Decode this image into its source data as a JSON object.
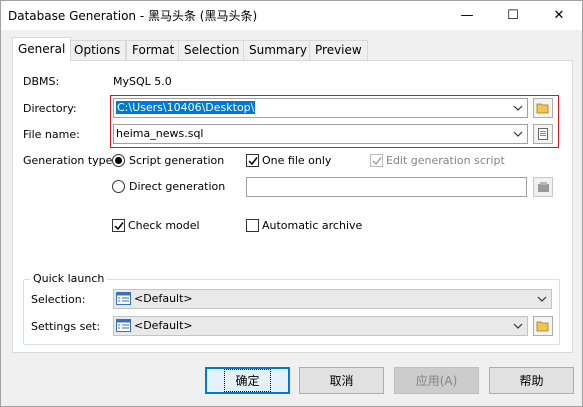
{
  "window": {
    "title": "Database Generation - 黑马头条 (黑马头条)",
    "controls": [
      "—",
      "☐",
      "✕"
    ]
  },
  "tabs": [
    {
      "label": "General",
      "active": true
    },
    {
      "label": "Options"
    },
    {
      "label": "Format"
    },
    {
      "label": "Selection"
    },
    {
      "label": "Summary"
    },
    {
      "label": "Preview"
    }
  ],
  "general": {
    "dbms_label": "DBMS:",
    "dbms_value": "MySQL 5.0",
    "directory_label": "Directory:",
    "directory_value": "C:\\Users\\10406\\Desktop\\",
    "filename_label": "File name:",
    "filename_value": "heima_news.sql",
    "generation_type_label": "Generation type:",
    "script_generation": "Script generation",
    "direct_generation": "Direct generation",
    "one_file_only": "One file only",
    "edit_generation_script": "Edit generation script",
    "check_model": "Check model",
    "automatic_archive": "Automatic archive"
  },
  "quick_launch": {
    "title": "Quick launch",
    "selection_label": "Selection:",
    "selection_value": "<Default>",
    "settings_label": "Settings set:",
    "settings_value": "<Default>"
  },
  "buttons": {
    "ok": "确定",
    "cancel": "取消",
    "apply": "应用(A)",
    "help": "帮助"
  },
  "colors": {
    "accent": "#0078d7",
    "highlight": "#e0141e"
  }
}
